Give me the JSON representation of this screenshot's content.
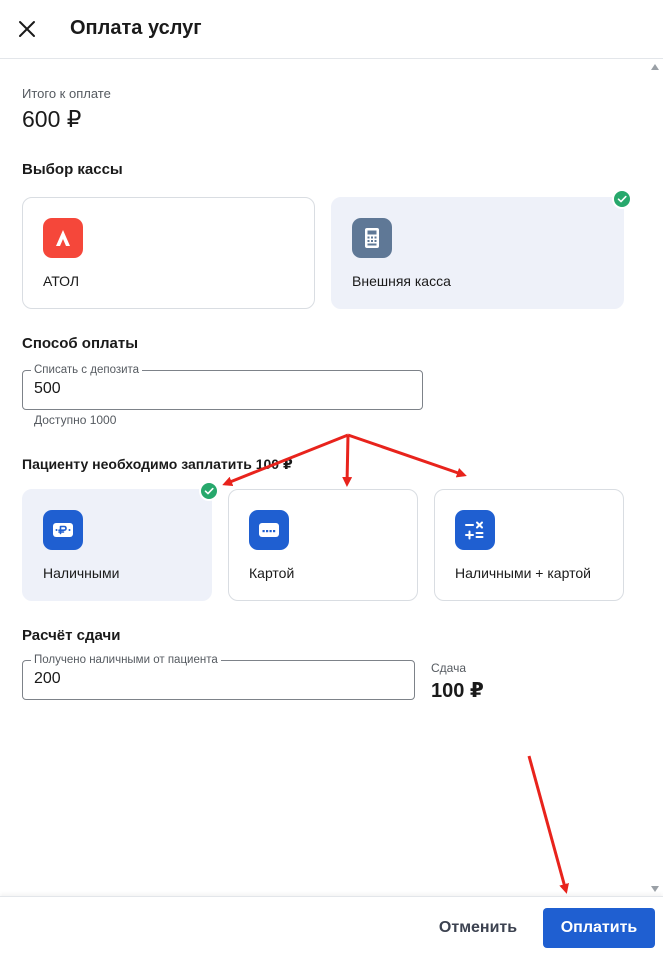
{
  "header": {
    "title": "Оплата услуг",
    "close_icon": "close-icon"
  },
  "summary": {
    "label": "Итого к оплате",
    "amount": "600 ₽"
  },
  "cashbox": {
    "title": "Выбор кассы",
    "options": [
      {
        "label": "АТОЛ",
        "icon": "atol-logo-icon",
        "color": "#f5473a",
        "selected": false
      },
      {
        "label": "Внешняя касса",
        "icon": "cash-register-icon",
        "color": "#5f7896",
        "selected": true
      }
    ]
  },
  "payment": {
    "title": "Способ оплаты",
    "deposit_field": {
      "legend": "Списать с депозита",
      "value": "500"
    },
    "available": "Доступно 1000",
    "patient_due": "Пациенту необходимо заплатить 100 ₽",
    "methods": [
      {
        "label": "Наличными",
        "icon": "cash-icon",
        "selected": true
      },
      {
        "label": "Картой",
        "icon": "card-icon",
        "selected": false
      },
      {
        "label": "Наличными + картой",
        "icon": "calculator-icon",
        "selected": false
      }
    ],
    "accent_color": "#1f5fd1"
  },
  "change": {
    "title": "Расчёт сдачи",
    "received_field": {
      "legend": "Получено наличными от пациента",
      "value": "200"
    },
    "change_label": "Сдача",
    "change_amount": "100 ₽"
  },
  "footer": {
    "cancel_label": "Отменить",
    "pay_label": "Оплатить"
  },
  "colors": {
    "selected_bg": "#eef1f9",
    "check": "#27a86c",
    "arrow": "#e8231c"
  }
}
